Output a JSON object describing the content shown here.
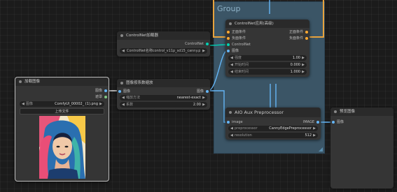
{
  "group": {
    "title": "Group"
  },
  "controlnet_apply": {
    "title": "ControlNet应用(高级)",
    "inputs": [
      "正面条件",
      "负面条件",
      "ControlNet",
      "图像"
    ],
    "outputs": [
      "正面条件",
      "负面条件"
    ],
    "widgets": [
      {
        "label": "强度",
        "value": "1.00"
      },
      {
        "label": "开始时间",
        "value": "0.000"
      },
      {
        "label": "结束时间",
        "value": "1.000"
      }
    ]
  },
  "controlnet_loader": {
    "title": "ControlNet加载器",
    "output": "ControlNet",
    "widget_value": "ControlNet名称control_v11p_sd15_canny.pth"
  },
  "load_image": {
    "title": "加载图像",
    "outputs": [
      "图像",
      "遮罩"
    ],
    "widget_label": "图像",
    "widget_value": "ComfyUI_00002_ (1).png",
    "upload_label": "上传文件"
  },
  "upscale": {
    "title": "图像按系数缩放",
    "input": "图像",
    "output": "图像",
    "widgets": [
      {
        "label": "缩放方法",
        "value": "nearest-exact"
      },
      {
        "label": "系数",
        "value": "2.00"
      }
    ]
  },
  "aio": {
    "title": "AIO Aux Preprocessor",
    "input": "image",
    "output": "IMAGE",
    "widgets": [
      {
        "label": "preprocessor",
        "value": "CannyEdgePreprocessor"
      },
      {
        "label": "resolution",
        "value": "512"
      }
    ]
  },
  "preview": {
    "title": "预览图像",
    "input": "图像"
  },
  "colors": {
    "image_wire": "#64b5f6",
    "controlnet_wire": "#00d2b4",
    "cond_wire": "#ffa931",
    "group_bg": "#3b5566",
    "selection": "#e8a33d"
  }
}
